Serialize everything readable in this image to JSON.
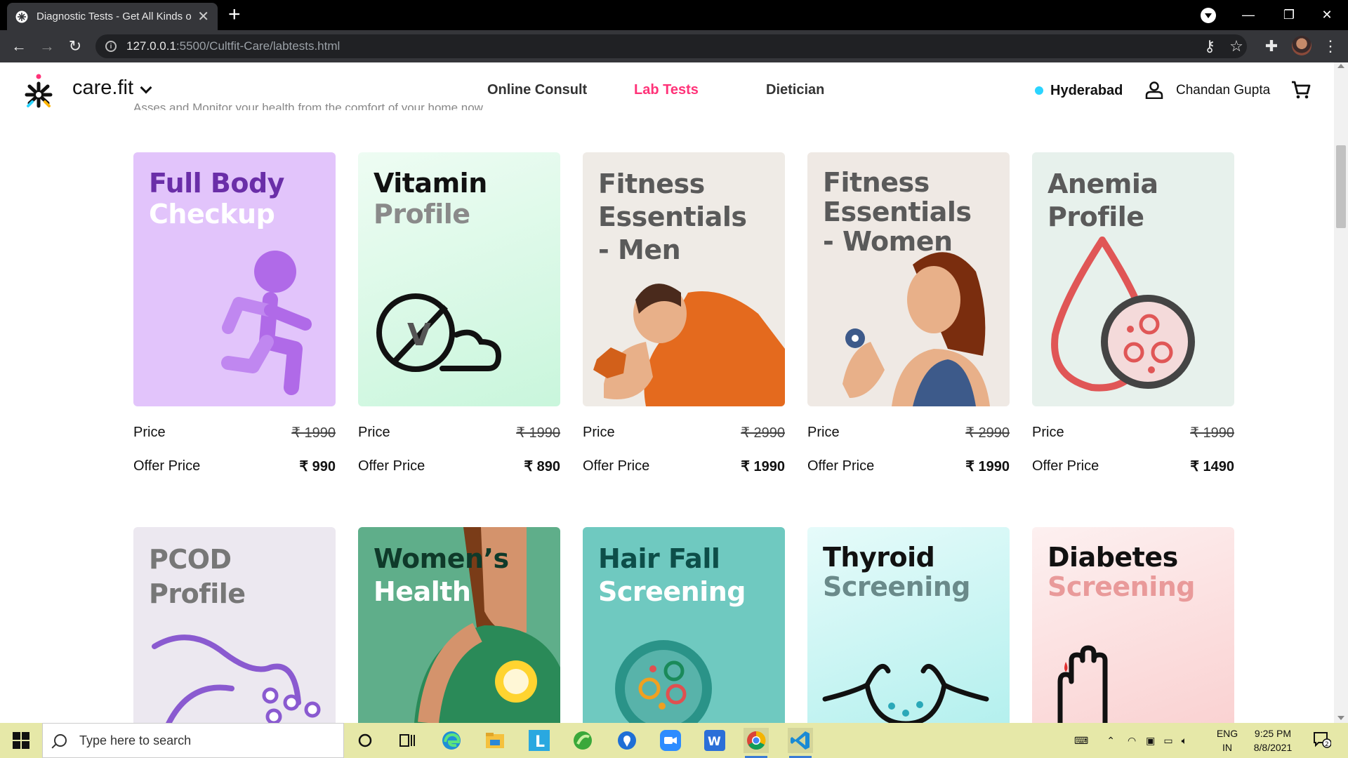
{
  "browser": {
    "tab_title": "Diagnostic Tests - Get All Kinds o",
    "url_host": "127.0.0.1",
    "url_path": ":5500/Cultfit-Care/labtests.html"
  },
  "header": {
    "brand": "care.fit",
    "nav": [
      "Online Consult",
      "Lab Tests",
      "Dietician"
    ],
    "active_nav": "Lab Tests",
    "location": "Hyderabad",
    "user_name": "Chandan Gupta",
    "subtitle": "Asses and Monitor your health from the comfort of your home now."
  },
  "labels": {
    "price": "Price",
    "offer_price": "Offer Price"
  },
  "cards": [
    {
      "title": [
        "Full Body",
        "Checkup"
      ],
      "price": "₹ 1990",
      "offer": "₹ 990",
      "bg": "#e2c4fb",
      "title_colors": [
        "#6a2ea8",
        "#ffffff"
      ]
    },
    {
      "title": [
        "Vitamin",
        "Profile"
      ],
      "price": "₹ 1990",
      "offer": "₹ 890",
      "bg": "#dff8ea",
      "title_colors": [
        "#111111",
        "#8a8a8a"
      ]
    },
    {
      "title": [
        "Fitness",
        "Essentials",
        "- Men"
      ],
      "price": "₹ 2990",
      "offer": "₹ 1990",
      "bg": "#efebe6",
      "title_colors": [
        "#5a5a5a",
        "#5a5a5a",
        "#5a5a5a"
      ]
    },
    {
      "title": [
        "Fitness",
        "Essentials",
        "- Women"
      ],
      "price": "₹ 2990",
      "offer": "₹ 1990",
      "bg": "#efe9e4",
      "title_colors": [
        "#5a5a5a",
        "#5a5a5a",
        "#5a5a5a"
      ]
    },
    {
      "title": [
        "Anemia",
        "Profile"
      ],
      "price": "₹ 1990",
      "offer": "₹ 1490",
      "bg": "#e7f1ec",
      "title_colors": [
        "#5a5a5a",
        "#5a5a5a"
      ]
    },
    {
      "title": [
        "PCOD",
        "Profile"
      ],
      "bg": "#ece8f0",
      "title_colors": [
        "#777777",
        "#777777"
      ]
    },
    {
      "title": [
        "Women’s",
        "Health"
      ],
      "bg": "#5fae8a",
      "title_colors": [
        "#0f3a2a",
        "#ffffff"
      ]
    },
    {
      "title": [
        "Hair Fall",
        "Screening"
      ],
      "bg": "#6fc9c0",
      "title_colors": [
        "#0d4e49",
        "#ffffff"
      ]
    },
    {
      "title": [
        "Thyroid",
        "Screening"
      ],
      "bg": "#c9f4f2",
      "title_colors": [
        "#111111",
        "#6a8a8a"
      ]
    },
    {
      "title": [
        "Diabetes",
        "Screening"
      ],
      "bg": "#fbe3e3",
      "title_colors": [
        "#111111",
        "#e99a9a"
      ]
    }
  ],
  "taskbar": {
    "search_placeholder": "Type here to search",
    "lang_top": "ENG",
    "lang_bottom": "IN",
    "time": "9:25 PM",
    "date": "8/8/2021",
    "notif_count": "2"
  }
}
